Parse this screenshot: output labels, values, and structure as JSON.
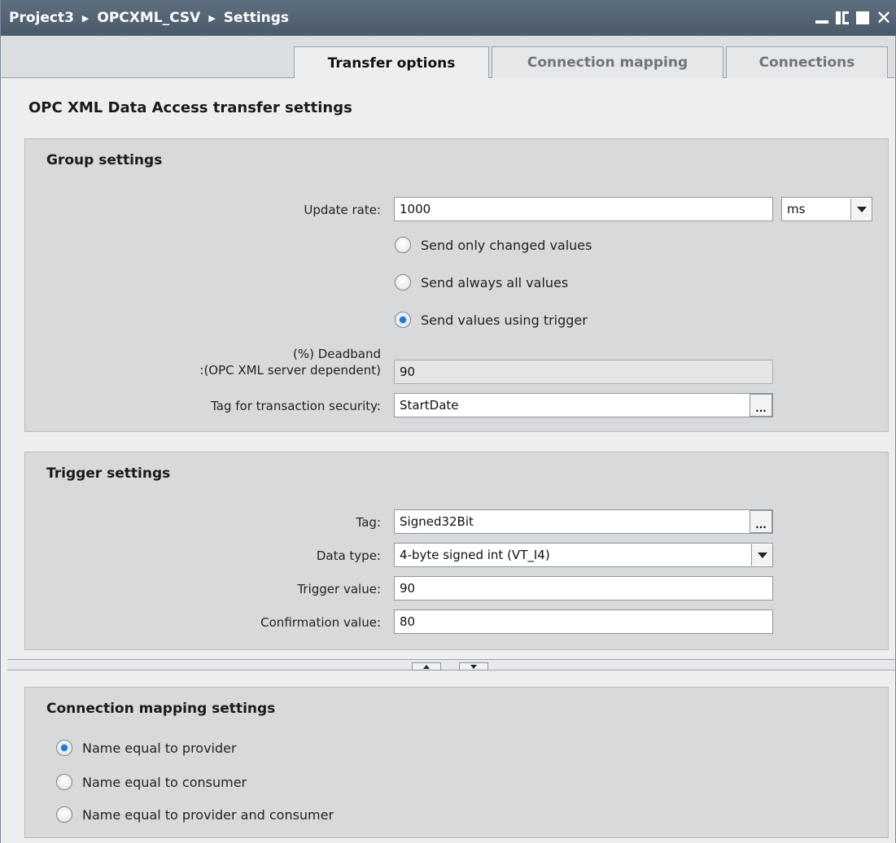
{
  "titlebar": {
    "breadcrumb": [
      "Project3",
      "OPCXML_CSV",
      "Settings"
    ],
    "separator": "▶"
  },
  "tabs": [
    {
      "label": "Transfer options",
      "active": true
    },
    {
      "label": "Connection mapping",
      "active": false
    },
    {
      "label": "Connections",
      "active": false
    }
  ],
  "page_title": "OPC XML Data Access transfer settings",
  "group_settings": {
    "title": "Group settings",
    "update_rate_label": "Update rate:",
    "update_rate_value": "1000",
    "update_rate_unit": "ms",
    "radios": [
      {
        "label": "Send only changed values",
        "checked": false
      },
      {
        "label": "Send always all values",
        "checked": false
      },
      {
        "label": "Send values using trigger",
        "checked": true
      }
    ],
    "deadband_label_line1": "(%) Deadband",
    "deadband_label_line2": ":(OPC XML server dependent)",
    "deadband_value": "90",
    "tag_security_label": "Tag for transaction security:",
    "tag_security_value": "StartDate",
    "browse_label": "..."
  },
  "trigger_settings": {
    "title": "Trigger settings",
    "tag_label": "Tag:",
    "tag_value": "Signed32Bit",
    "browse_label": "...",
    "data_type_label": "Data type:",
    "data_type_value": "4-byte signed int (VT_I4)",
    "trigger_value_label": "Trigger value:",
    "trigger_value": "90",
    "confirmation_value_label": "Confirmation value:",
    "confirmation_value": "80"
  },
  "connection_mapping": {
    "title": "Connection mapping settings",
    "radios": [
      {
        "label": "Name equal to provider",
        "checked": true
      },
      {
        "label": "Name equal to consumer",
        "checked": false
      },
      {
        "label": "Name equal to provider and consumer",
        "checked": false
      }
    ]
  },
  "colors": {
    "titlebar": "#4f6070",
    "radio_selected": "#1a7bd0"
  }
}
